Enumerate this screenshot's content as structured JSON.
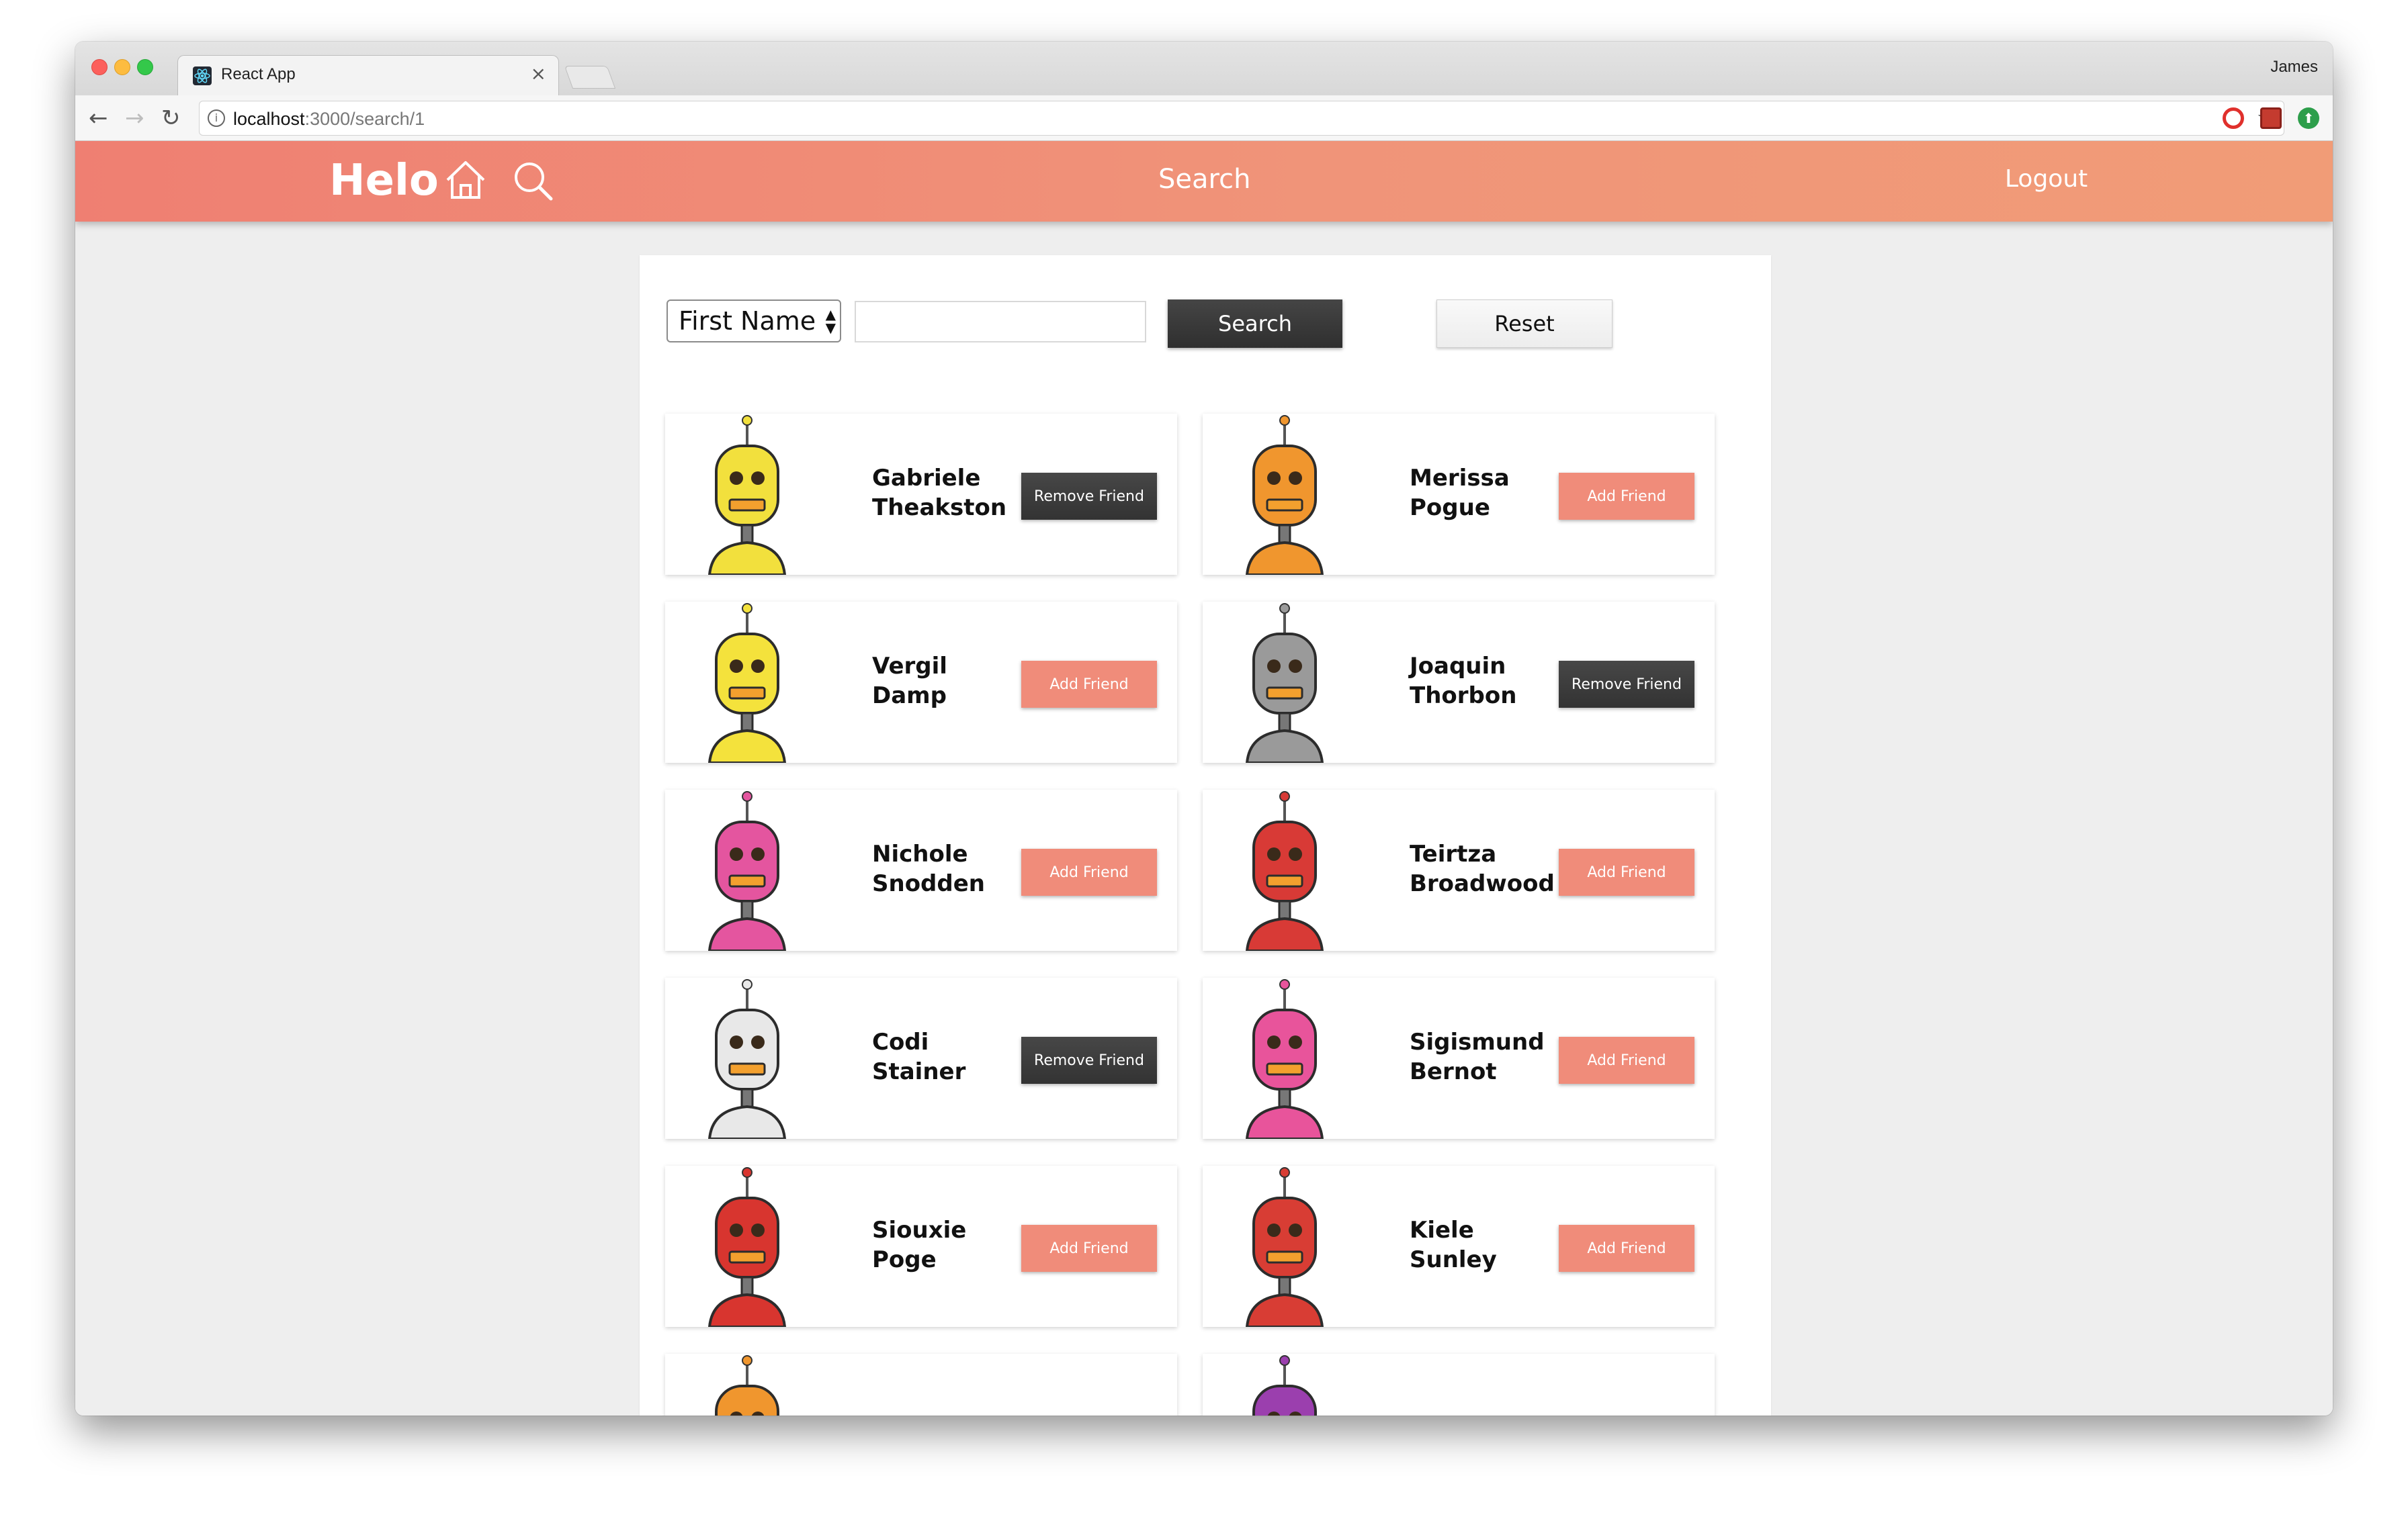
{
  "browser": {
    "tab_title": "React App",
    "tab_close": "×",
    "profile": "James",
    "url_host": "localhost",
    "url_rest": ":3000/search/1",
    "nav_back": "←",
    "nav_forward": "→",
    "nav_reload": "↻",
    "star": "☆"
  },
  "header": {
    "brand": "Helo",
    "nav_search": "Search",
    "nav_logout": "Logout"
  },
  "search": {
    "field_selected": "First Name",
    "query_value": "",
    "search_label": "Search",
    "reset_label": "Reset"
  },
  "people": [
    {
      "first": "Gabriele",
      "last": "Theakston",
      "action": "Remove Friend",
      "is_friend": true,
      "color": "#f2e03d"
    },
    {
      "first": "Merissa",
      "last": "Pogue",
      "action": "Add Friend",
      "is_friend": false,
      "color": "#f0962e"
    },
    {
      "first": "Vergil",
      "last": "Damp",
      "action": "Add Friend",
      "is_friend": false,
      "color": "#f4e23c"
    },
    {
      "first": "Joaquin",
      "last": "Thorbon",
      "action": "Remove Friend",
      "is_friend": true,
      "color": "#9a9a9a"
    },
    {
      "first": "Nichole",
      "last": "Snodden",
      "action": "Add Friend",
      "is_friend": false,
      "color": "#e4559f"
    },
    {
      "first": "Teirtza",
      "last": "Broadwood",
      "action": "Add Friend",
      "is_friend": false,
      "color": "#d83a36"
    },
    {
      "first": "Codi",
      "last": "Stainer",
      "action": "Remove Friend",
      "is_friend": true,
      "color": "#e8e8e8"
    },
    {
      "first": "Sigismund",
      "last": "Bernot",
      "action": "Add Friend",
      "is_friend": false,
      "color": "#e8549b"
    },
    {
      "first": "Siouxie",
      "last": "Poge",
      "action": "Add Friend",
      "is_friend": false,
      "color": "#d8352f"
    },
    {
      "first": "Kiele",
      "last": "Sunley",
      "action": "Add Friend",
      "is_friend": false,
      "color": "#d83d34"
    },
    {
      "first": "",
      "last": "",
      "action": "",
      "is_friend": false,
      "color": "#f0962e"
    },
    {
      "first": "",
      "last": "",
      "action": "",
      "is_friend": false,
      "color": "#9b3fae"
    }
  ]
}
